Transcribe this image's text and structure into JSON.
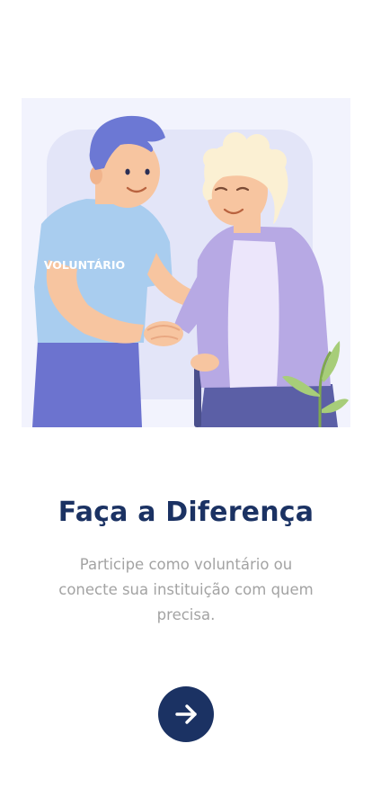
{
  "hero": {
    "shirt_text": "VOLUNTÁRIO"
  },
  "onboarding": {
    "title": "Faça a Diferença",
    "subtitle": "Participe como voluntário ou conecte sua instituição com quem precisa."
  },
  "next_button": {
    "icon": "arrow-right-icon"
  },
  "colors": {
    "primary": "#1b3263",
    "subtitle": "#a3a3a3",
    "hero_bg": "#f2f3fd"
  }
}
